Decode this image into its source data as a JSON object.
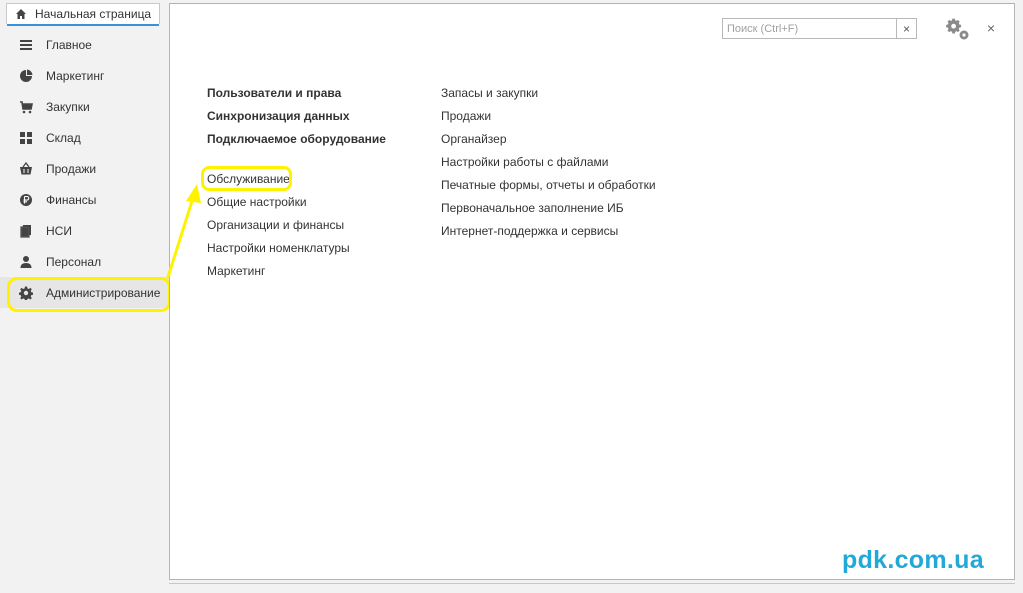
{
  "home_tab": {
    "label": "Начальная страница",
    "icon": "home-icon"
  },
  "sidebar": {
    "items": [
      {
        "label": "Главное",
        "icon": "list-icon"
      },
      {
        "label": "Маркетинг",
        "icon": "pie-chart-icon"
      },
      {
        "label": "Закупки",
        "icon": "cart-icon"
      },
      {
        "label": "Склад",
        "icon": "warehouse-grid-icon"
      },
      {
        "label": "Продажи",
        "icon": "basket-icon"
      },
      {
        "label": "Финансы",
        "icon": "currency-icon"
      },
      {
        "label": "НСИ",
        "icon": "documents-icon"
      },
      {
        "label": "Персонал",
        "icon": "person-icon"
      },
      {
        "label": "Администрирование",
        "icon": "gear-icon"
      }
    ],
    "active_index": 8
  },
  "toolbar": {
    "search_placeholder": "Поиск (Ctrl+F)",
    "search_clear": "×",
    "close": "×"
  },
  "content": {
    "left_column": {
      "bold_links": [
        "Пользователи и права",
        "Синхронизация данных",
        "Подключаемое оборудование"
      ],
      "links": [
        "Обслуживание",
        "Общие настройки",
        "Организации и финансы",
        "Настройки номенклатуры",
        "Маркетинг"
      ]
    },
    "right_column": {
      "links": [
        "Запасы и закупки",
        "Продажи",
        "Органайзер",
        "Настройки работы с файлами",
        "Печатные формы, отчеты и обработки",
        "Первоначальное заполнение ИБ",
        "Интернет-поддержка и сервисы"
      ]
    }
  },
  "watermark": "pdk.com.ua",
  "colors": {
    "highlight": "#fff200",
    "watermark": "#23a9d8",
    "tab_accent": "#3d8fd6"
  }
}
